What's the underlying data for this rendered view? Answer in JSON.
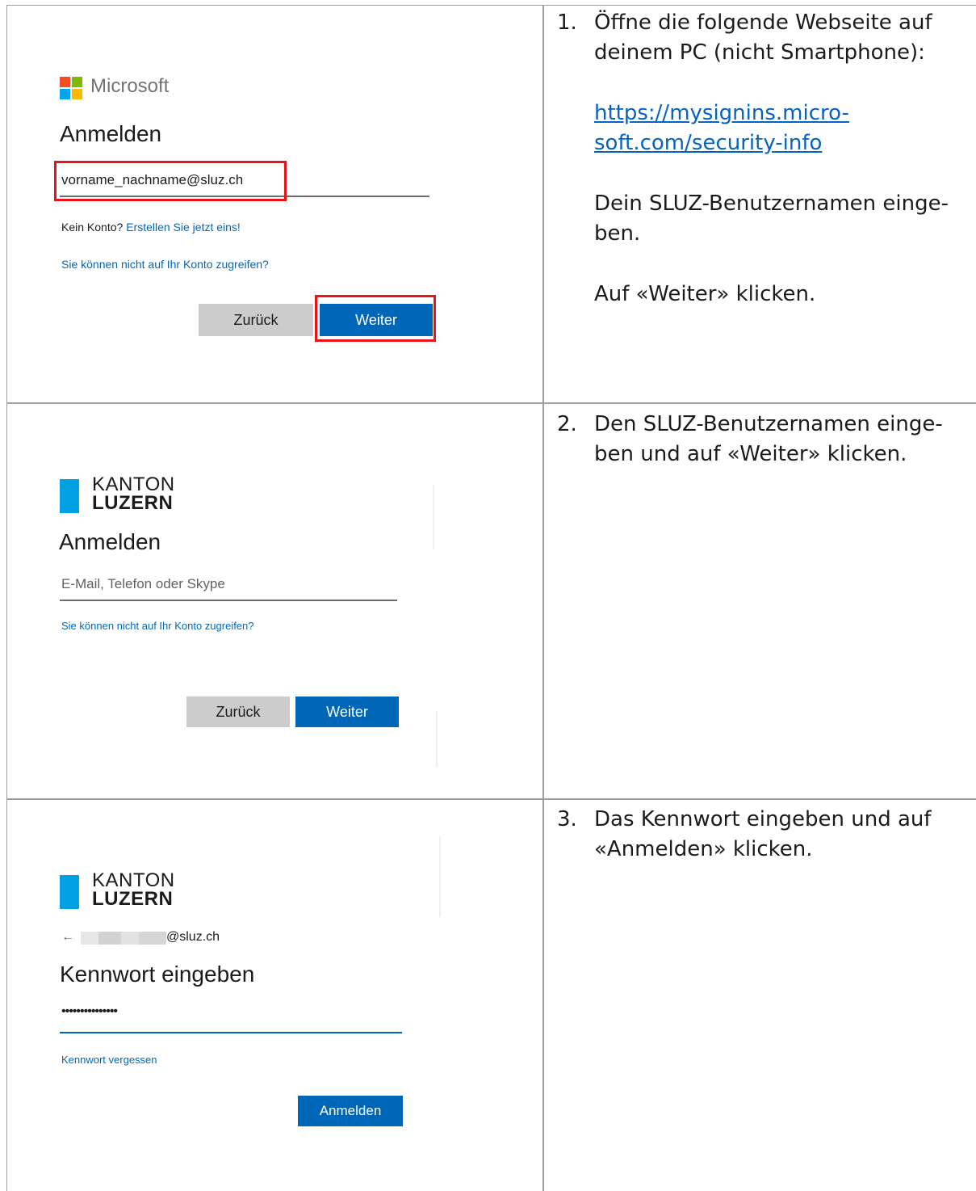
{
  "steps": [
    {
      "number": "1.",
      "paragraphs": [
        "Öffne die folgende Webseite auf deinem PC (nicht Smartphone):"
      ],
      "link": "https://mysignins.microsoft.com/security-info",
      "link_line1": "https://mysignins.micro-",
      "link_line2": "soft.com/security-info",
      "line_a": "Dein SLUZ-Benutzernamen einge-",
      "line_b": "ben.",
      "line_c": "Auf «Weiter» klicken."
    },
    {
      "number": "2.",
      "line_a": "Den SLUZ-Benutzernamen einge-",
      "line_b": "ben und auf «Weiter» klicken."
    },
    {
      "number": "3.",
      "line_a": "Das Kennwort eingeben und auf",
      "line_b": "«Anmelden» klicken."
    }
  ],
  "screen1": {
    "brand": "Microsoft",
    "heading": "Anmelden",
    "email_value": "vorname_nachname@sluz.ch",
    "no_account_text": "Kein Konto?",
    "create_link": "Erstellen Sie jetzt eins!",
    "access_link": "Sie können nicht auf Ihr Konto zugreifen?",
    "back_label": "Zurück",
    "next_label": "Weiter"
  },
  "screen2": {
    "brand_top": "KANTON",
    "brand_bottom": "LUZERN",
    "heading": "Anmelden",
    "email_placeholder": "E-Mail, Telefon oder Skype",
    "access_link": "Sie können nicht auf Ihr Konto zugreifen?",
    "back_label": "Zurück",
    "next_label": "Weiter"
  },
  "screen3": {
    "brand_top": "KANTON",
    "brand_bottom": "LUZERN",
    "back_arrow": "←",
    "email_suffix": "@sluz.ch",
    "heading": "Kennwort eingeben",
    "password_value": "•••••••••••••••",
    "forgot_link": "Kennwort vergessen",
    "signin_label": "Anmelden"
  },
  "colors": {
    "link_blue": "#0067b8",
    "doc_link_blue": "#0563c1",
    "highlight_red": "#e8141a",
    "kanton_blue": "#00a0e3"
  }
}
